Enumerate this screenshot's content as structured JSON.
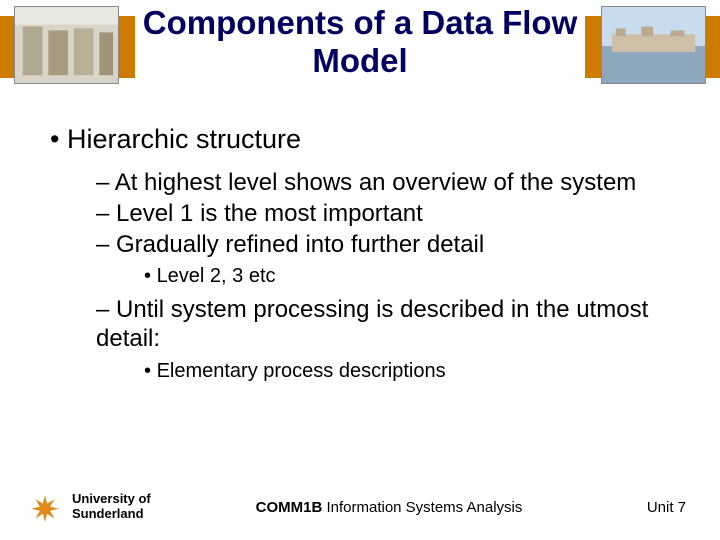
{
  "title": "Components of a Data Flow Model",
  "bullets": {
    "l1": "Hierarchic structure",
    "l2a": "At highest level shows an overview of the system",
    "l2b": "Level 1 is the most important",
    "l2c": "Gradually refined into further detail",
    "l3a": "Level 2, 3 etc",
    "l2d": "Until system processing is described in the utmost detail:",
    "l3b": "Elementary process descriptions"
  },
  "footer": {
    "uni_line1": "University of",
    "uni_line2": "Sunderland",
    "course_code": "COMM1B",
    "course_name": " Information Systems Analysis",
    "unit": "Unit 7"
  }
}
